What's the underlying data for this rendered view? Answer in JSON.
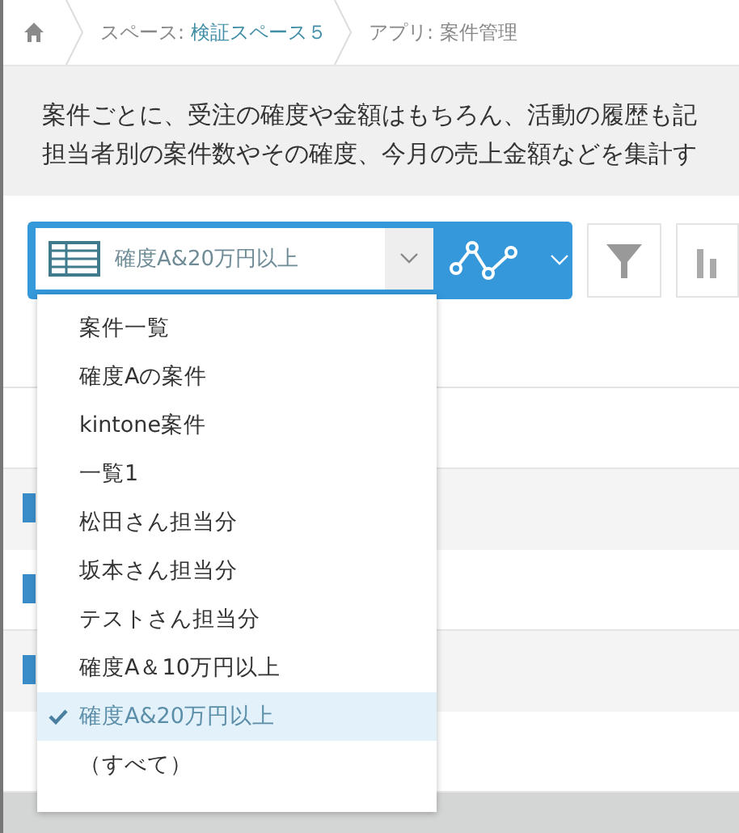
{
  "breadcrumb": {
    "space_label": "スペース:",
    "space_name": "検証スペース５",
    "app": "アプリ: 案件管理"
  },
  "description": [
    "案件ごとに、受注の確度や金額はもちろん、活動の履歴も記",
    "担当者別の案件数やその確度、今月の売上金額などを集計す"
  ],
  "view_select": {
    "value": "確度A&20万円以上"
  },
  "view_menu": [
    {
      "label": "案件一覧",
      "selected": false
    },
    {
      "label": "確度Aの案件",
      "selected": false
    },
    {
      "label": "kintone案件",
      "selected": false
    },
    {
      "label": "一覧1",
      "selected": false
    },
    {
      "label": "松田さん担当分",
      "selected": false
    },
    {
      "label": "坂本さん担当分",
      "selected": false
    },
    {
      "label": "テストさん担当分",
      "selected": false
    },
    {
      "label": "確度A＆10万円以上",
      "selected": false
    },
    {
      "label": "確度A&20万円以上",
      "selected": true
    },
    {
      "label": "（すべて）",
      "selected": false
    }
  ]
}
